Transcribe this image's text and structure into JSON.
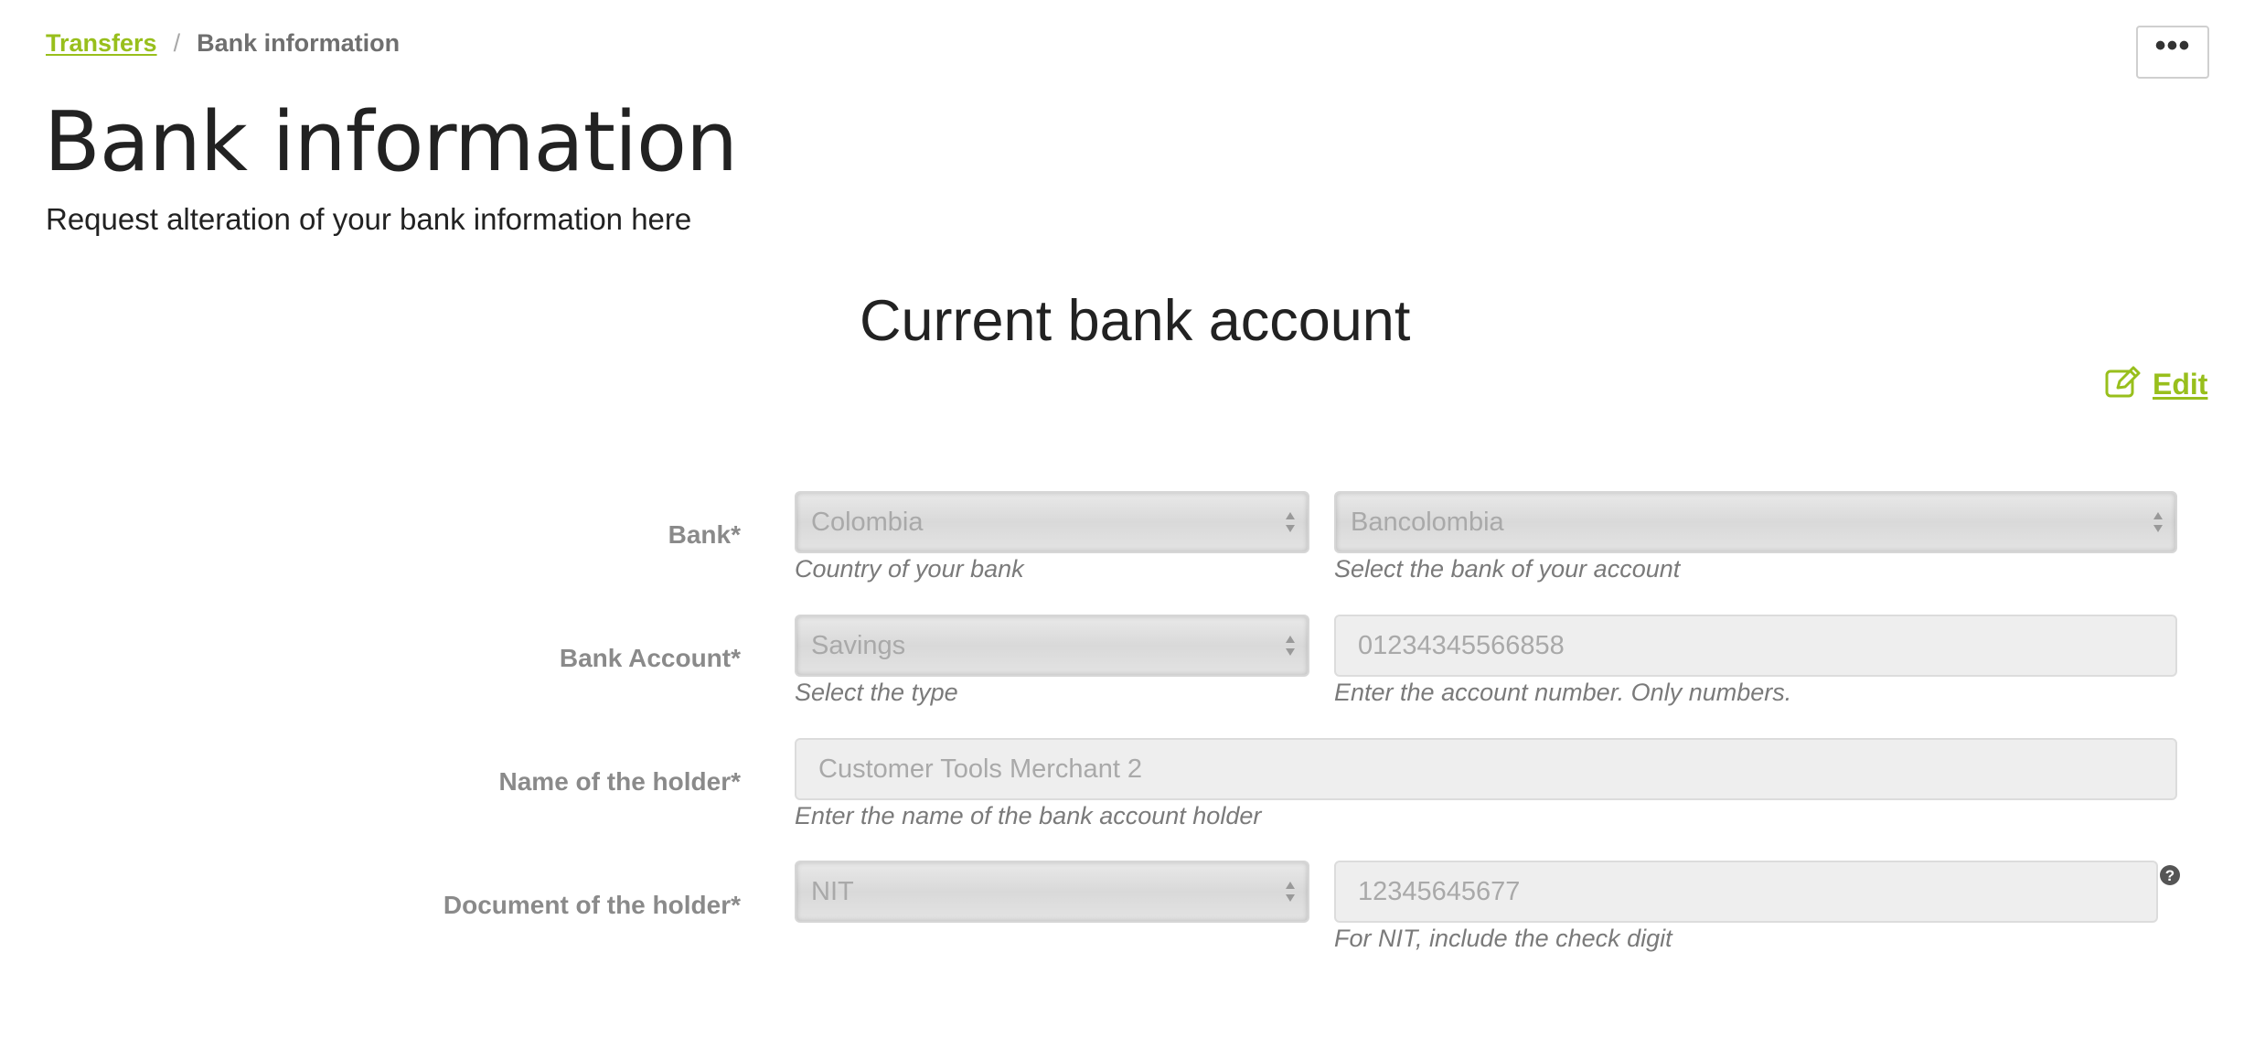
{
  "breadcrumb": {
    "parent": "Transfers",
    "separator": "/",
    "current": "Bank information"
  },
  "header": {
    "more_label": "•••",
    "title": "Bank information",
    "subtitle": "Request alteration of your bank information here"
  },
  "section": {
    "title": "Current bank account",
    "edit_label": "Edit"
  },
  "form": {
    "bank": {
      "label": "Bank*",
      "country_value": "Colombia",
      "country_help": "Country of your bank",
      "bank_value": "Bancolombia",
      "bank_help": "Select the bank of your account"
    },
    "account": {
      "label": "Bank Account*",
      "type_value": "Savings",
      "type_help": "Select the type",
      "number_value": "01234345566858",
      "number_help": "Enter the account number. Only numbers."
    },
    "holder_name": {
      "label": "Name of the holder*",
      "value": "Customer Tools Merchant 2",
      "help": "Enter the name of the bank account holder"
    },
    "holder_document": {
      "label": "Document of the holder*",
      "type_value": "NIT",
      "number_value": "12345645677",
      "help": "For NIT, include the check digit",
      "help_icon": "?"
    }
  },
  "colors": {
    "accent": "#98bf1c",
    "label": "#8a8a8a",
    "field_text": "#a9a9a9",
    "help_text": "#7a7a7a"
  },
  "icons": {
    "edit": "edit-icon",
    "more": "more-icon",
    "help": "help-icon",
    "select_arrows": "select-arrows-icon"
  }
}
